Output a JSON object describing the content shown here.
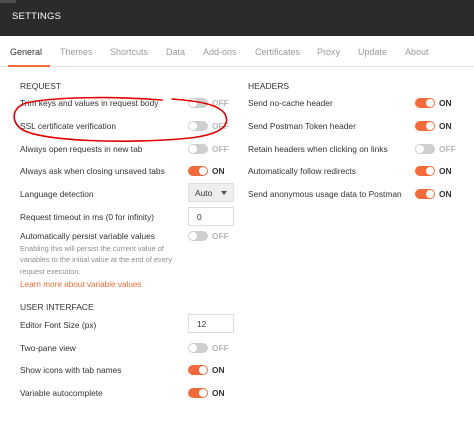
{
  "window": {
    "title": "SETTINGS"
  },
  "tabs": [
    {
      "label": "General",
      "active": true
    },
    {
      "label": "Themes"
    },
    {
      "label": "Shortcuts"
    },
    {
      "label": "Data"
    },
    {
      "label": "Add-ons"
    },
    {
      "label": "Certificates"
    },
    {
      "label": "Proxy"
    },
    {
      "label": "Update"
    },
    {
      "label": "About"
    }
  ],
  "request": {
    "heading": "REQUEST",
    "trim_keys": {
      "label": "Trim keys and values in request body",
      "state": "OFF"
    },
    "ssl_verification": {
      "label": "SSL certificate verification",
      "state": "OFF"
    },
    "open_in_new_tab": {
      "label": "Always open requests in new tab",
      "state": "OFF"
    },
    "ask_closing_unsaved": {
      "label": "Always ask when closing unsaved tabs",
      "state": "ON"
    },
    "language_detection": {
      "label": "Language detection",
      "value": "Auto"
    },
    "request_timeout": {
      "label": "Request timeout in ms (0 for infinity)",
      "value": "0"
    },
    "persist_variables": {
      "label": "Automatically persist variable values",
      "state": "OFF",
      "description": "Enabling this will persist the current value of variables to the initial value at the end of every request execution.",
      "link": "Learn more about variable values"
    }
  },
  "headers": {
    "heading": "HEADERS",
    "no_cache": {
      "label": "Send no-cache header",
      "state": "ON"
    },
    "postman_token": {
      "label": "Send Postman Token header",
      "state": "ON"
    },
    "retain_headers": {
      "label": "Retain headers when clicking on links",
      "state": "OFF"
    },
    "follow_redirects": {
      "label": "Automatically follow redirects",
      "state": "ON"
    },
    "anonymous_usage": {
      "label": "Send anonymous usage data to Postman",
      "state": "ON"
    }
  },
  "ui": {
    "heading": "USER INTERFACE",
    "font_size": {
      "label": "Editor Font Size (px)",
      "value": "12"
    },
    "two_pane": {
      "label": "Two-pane view",
      "state": "OFF"
    },
    "tab_icons": {
      "label": "Show icons with tab names",
      "state": "ON"
    },
    "variable_autocomplete": {
      "label": "Variable autocomplete",
      "state": "ON"
    }
  },
  "colors": {
    "accent": "#f26b3a",
    "titlebar": "#2b2b2b",
    "annotation": "#e00000"
  }
}
